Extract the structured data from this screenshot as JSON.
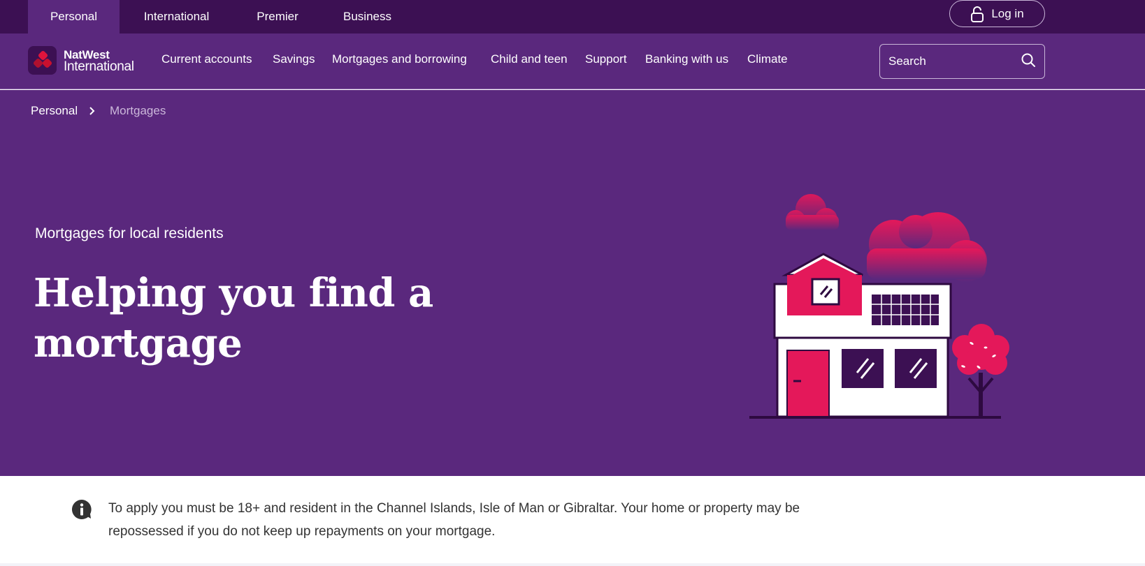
{
  "top_bar": {
    "segments": [
      "Personal",
      "International",
      "Premier",
      "Business"
    ],
    "active_segment": "Personal",
    "login_label": "Log in"
  },
  "brand": {
    "name_line1": "NatWest",
    "name_line2": "International"
  },
  "main_nav": {
    "items": [
      "Current accounts",
      "Savings",
      "Mortgages and borrowing",
      "Child and teen",
      "Support",
      "Banking with us",
      "Climate"
    ],
    "search_placeholder": "Search"
  },
  "breadcrumb": {
    "items": [
      "Personal",
      "Mortgages"
    ]
  },
  "hero": {
    "eyebrow": "Mortgages for local residents",
    "headline_line1": "Helping you find a",
    "headline_line2": "mortgage"
  },
  "notice": {
    "text": "To apply you must be 18+ and resident in the Channel Islands, Isle of Man or Gibraltar. Your home or property may be repossessed if you do not keep up repayments on your mortgage."
  },
  "colors": {
    "top_bar": "#3c1053",
    "nav": "#5a287d",
    "hero": "#5a287d",
    "accent_pink": "#e4185a",
    "text_dark": "#333333"
  },
  "icons": [
    "lock-icon",
    "natwest-logo-icon",
    "search-icon",
    "chevron-right-icon",
    "info-icon",
    "house-illustration"
  ]
}
